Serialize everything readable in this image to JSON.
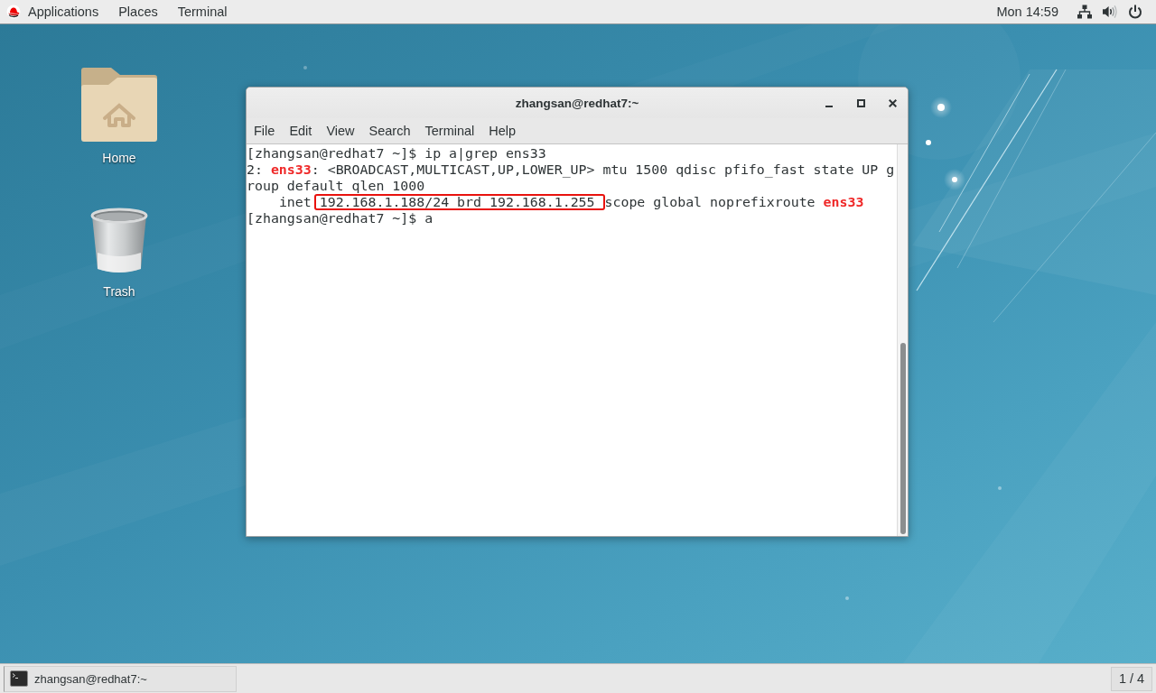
{
  "top_bar": {
    "menus": [
      {
        "label": "Applications",
        "kind": "logo"
      },
      {
        "label": "Places",
        "kind": "plain"
      },
      {
        "label": "Terminal",
        "kind": "plain"
      }
    ],
    "clock": "Mon 14:59"
  },
  "desktop": {
    "icons": [
      {
        "label": "Home",
        "kind": "folder"
      },
      {
        "label": "Trash",
        "kind": "trash"
      }
    ]
  },
  "window": {
    "title": "zhangsan@redhat7:~",
    "menu": [
      "File",
      "Edit",
      "View",
      "Search",
      "Terminal",
      "Help"
    ],
    "terminal": {
      "lines": [
        [
          {
            "text": "[zhangsan@redhat7 ~]$ ip a|grep ens33",
            "kind": "plain"
          }
        ],
        [
          {
            "text": "2: ",
            "kind": "plain"
          },
          {
            "text": "ens33",
            "kind": "keyword"
          },
          {
            "text": ": <BROADCAST,MULTICAST,UP,LOWER_UP> mtu 1500 qdisc pfifo_fast state UP g",
            "kind": "plain"
          }
        ],
        [
          {
            "text": "roup default qlen 1000",
            "kind": "plain"
          }
        ],
        [
          {
            "text": "    inet ",
            "kind": "plain"
          },
          {
            "text": "192.168.1.188/24 brd 192.168.1.255 ",
            "kind": "boxed"
          },
          {
            "text": "scope global noprefixroute ",
            "kind": "plain"
          },
          {
            "text": "ens33",
            "kind": "keyword"
          }
        ],
        [
          {
            "text": "[zhangsan@redhat7 ~]$ a",
            "kind": "plain"
          }
        ]
      ]
    }
  },
  "taskbar": {
    "tasks": [
      {
        "label": "zhangsan@redhat7:~"
      }
    ],
    "workspace": "1 / 4"
  }
}
